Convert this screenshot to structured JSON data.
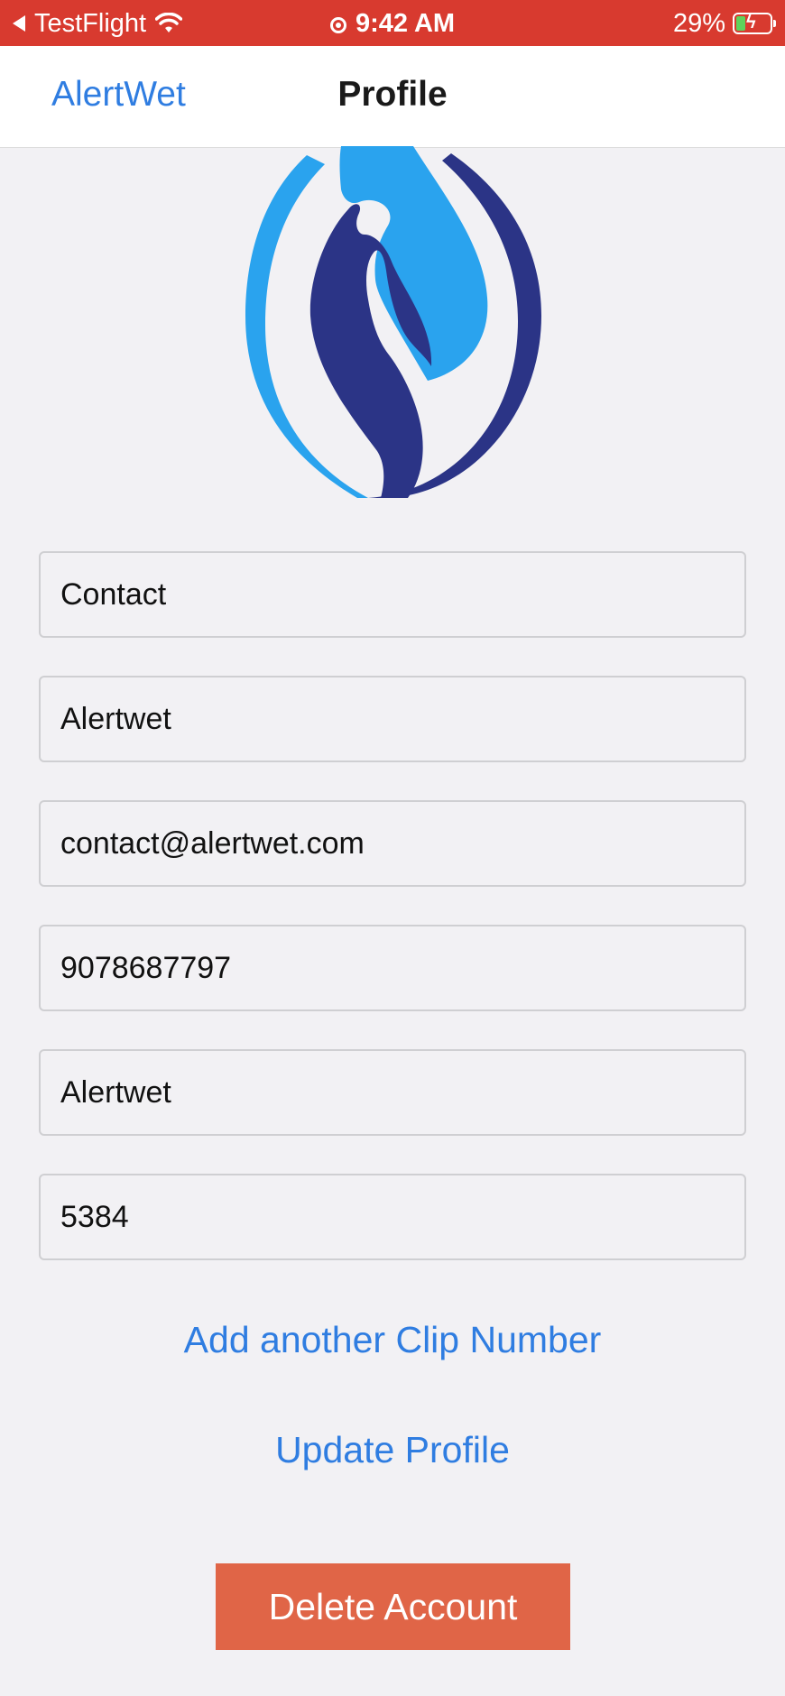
{
  "status_bar": {
    "back_app": "TestFlight",
    "time": "9:42 AM",
    "battery_percent": "29%",
    "icons": [
      "back-arrow-icon",
      "wifi-icon",
      "location-icon",
      "battery-charging-icon"
    ]
  },
  "nav": {
    "back_label": "AlertWet",
    "title": "Profile"
  },
  "logo": {
    "icon": "water-drop-hand-logo",
    "colors": {
      "light_blue": "#2aa3ee",
      "dark_blue": "#2b3486"
    }
  },
  "form": {
    "fields": [
      {
        "value": "Contact"
      },
      {
        "value": "Alertwet"
      },
      {
        "value": "contact@alertwet.com"
      },
      {
        "value": "9078687797"
      },
      {
        "value": "Alertwet"
      },
      {
        "value": "5384"
      }
    ]
  },
  "actions": {
    "add_clip": "Add another Clip Number",
    "update_profile": "Update Profile",
    "delete_account": "Delete Account"
  },
  "colors": {
    "status_bar": "#d83a2f",
    "accent": "#2f7de1",
    "danger": "#e06547",
    "background": "#f2f1f4"
  }
}
